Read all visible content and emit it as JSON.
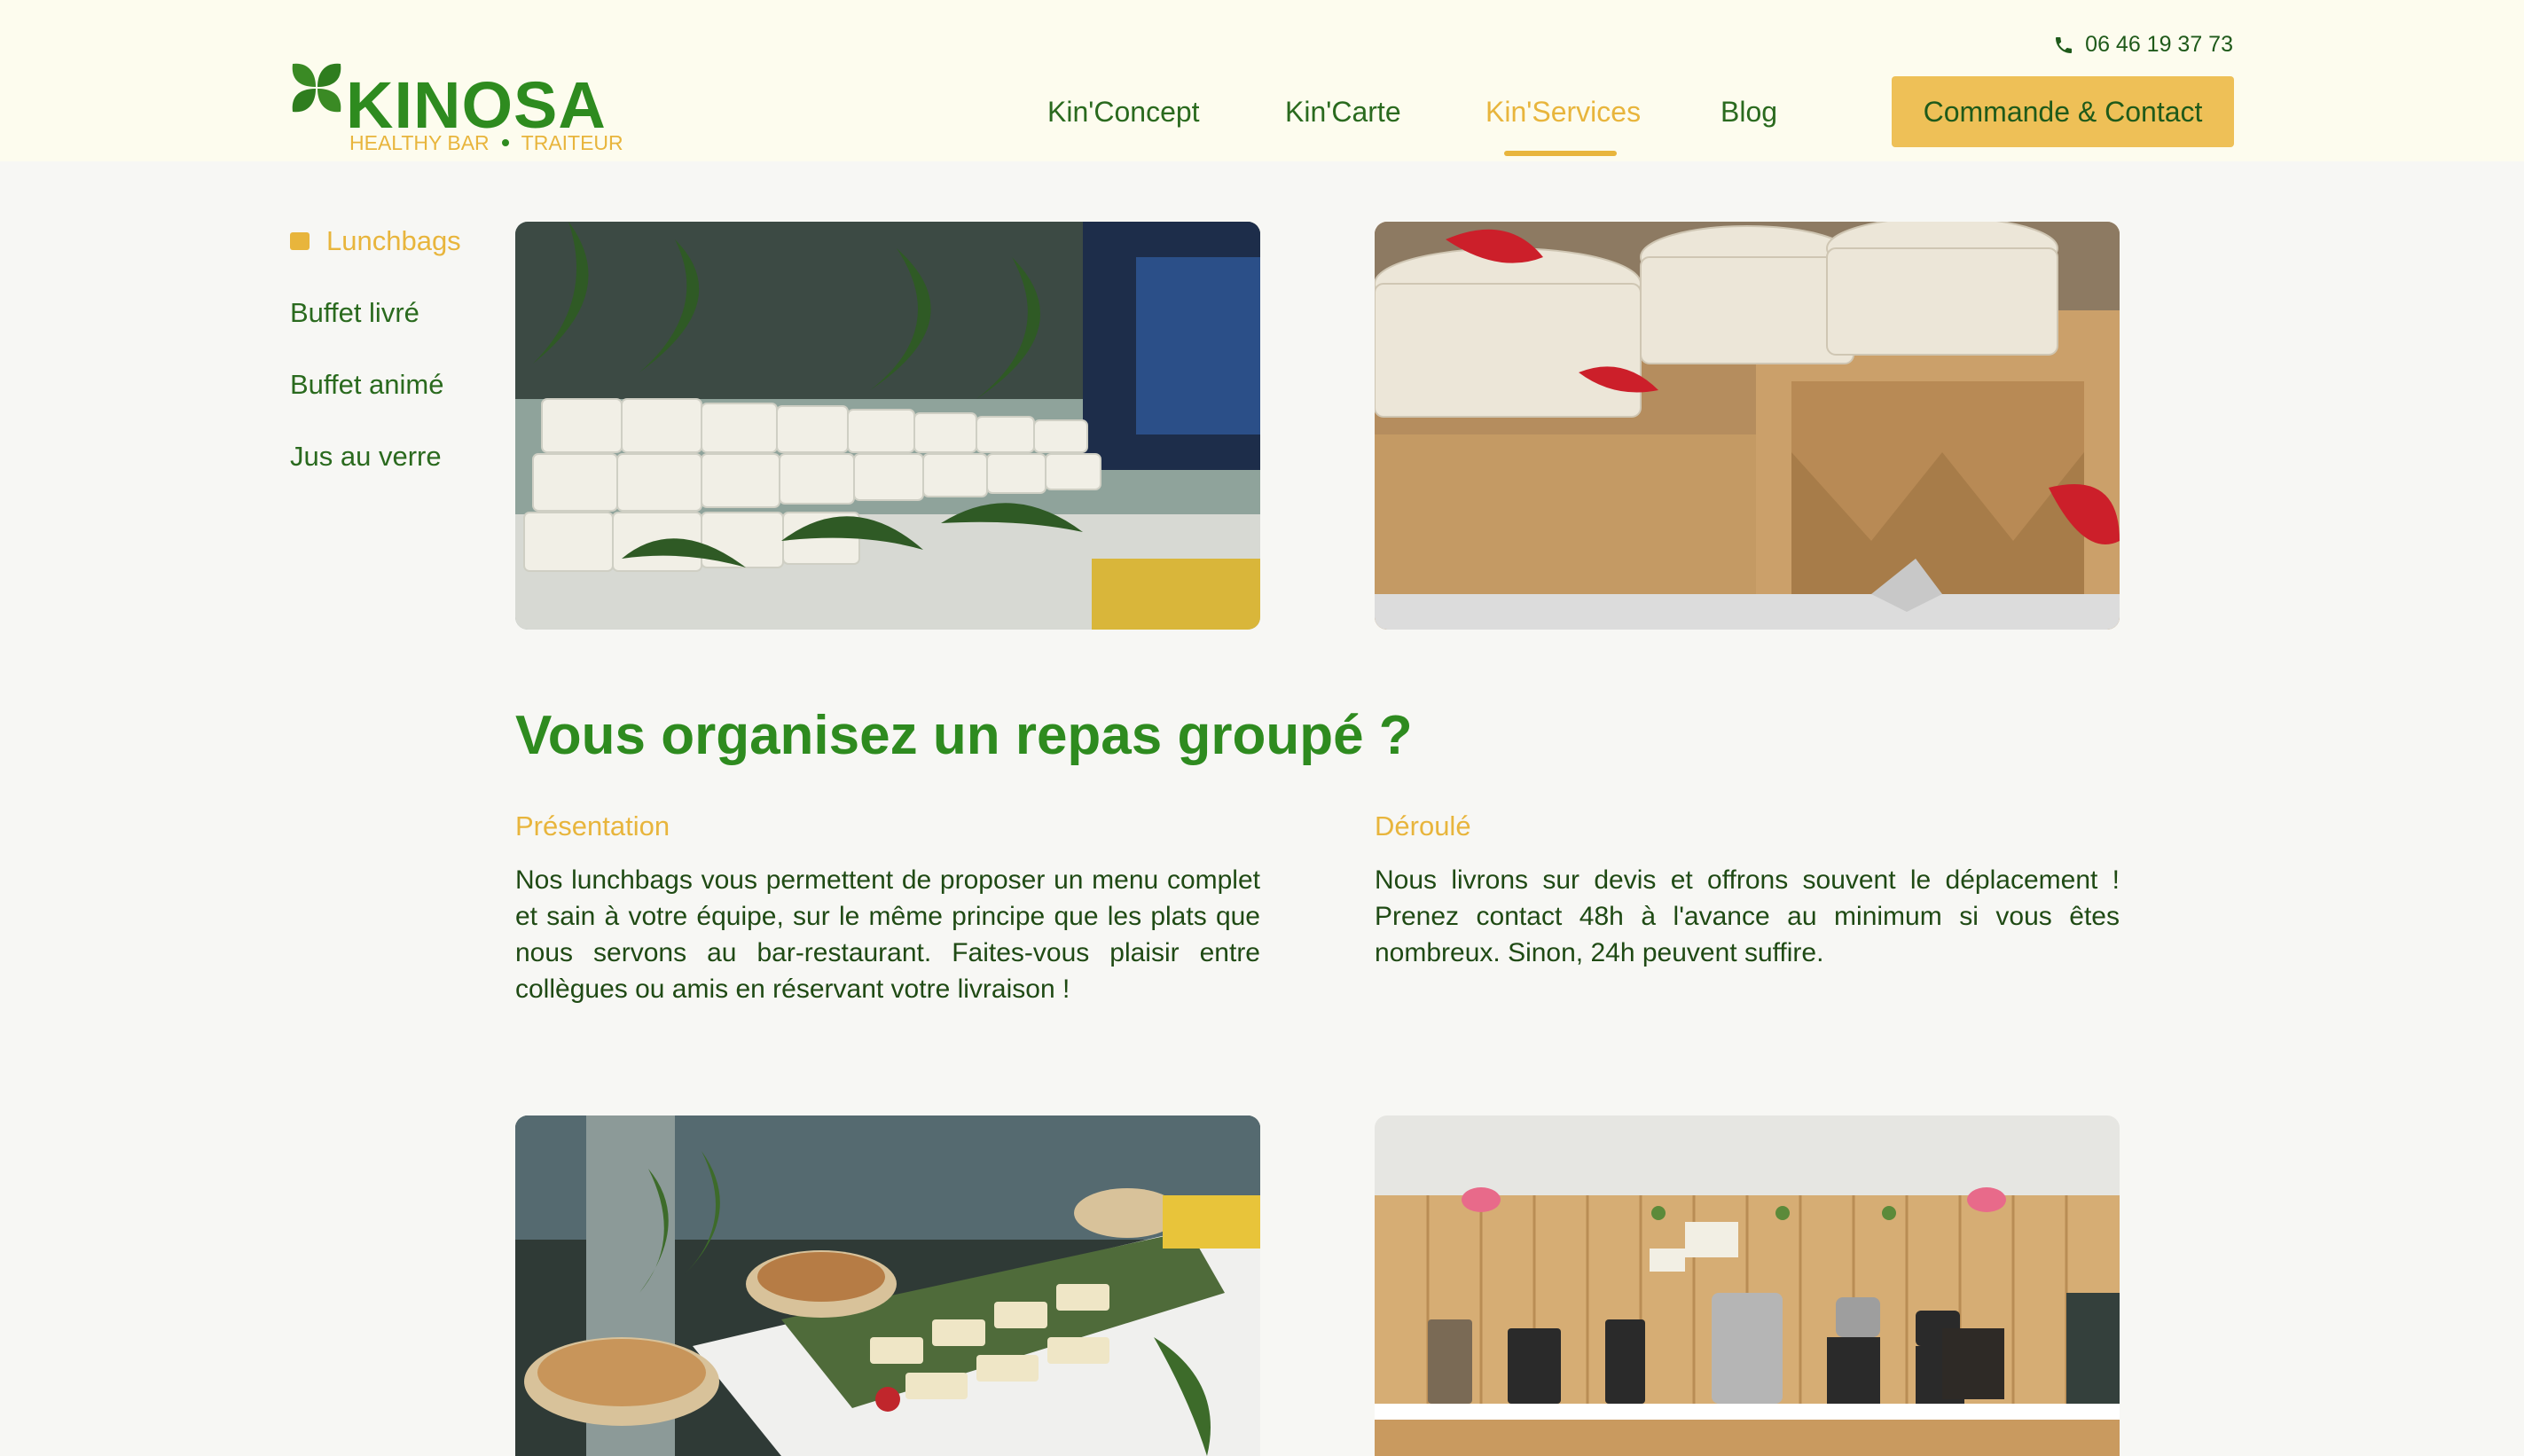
{
  "brand": {
    "name": "KINOSA",
    "tagline_left": "HEALTHY BAR",
    "tagline_right": "TRAITEUR",
    "colors": {
      "green": "#2e8b1f",
      "dark_green": "#1f5a1a",
      "accent": "#e8b53c",
      "header_bg": "#fdfcee"
    }
  },
  "header": {
    "phone": "06 46 19 37 73",
    "nav": [
      {
        "label": "Kin'Concept",
        "active": false
      },
      {
        "label": "Kin'Carte",
        "active": false
      },
      {
        "label": "Kin'Services",
        "active": true
      },
      {
        "label": "Blog",
        "active": false
      }
    ],
    "cta_label": "Commande & Contact"
  },
  "sidebar": {
    "items": [
      {
        "label": "Lunchbags",
        "active": true
      },
      {
        "label": "Buffet livré",
        "active": false
      },
      {
        "label": "Buffet animé",
        "active": false
      },
      {
        "label": "Jus au verre",
        "active": false
      }
    ]
  },
  "main": {
    "photos": [
      {
        "icon": "lunchbag-bowls-photo"
      },
      {
        "icon": "kraft-boxes-photo"
      },
      {
        "icon": "buffet-table-photo"
      },
      {
        "icon": "juice-bar-stand-photo"
      }
    ],
    "title": "Vous organisez un repas groupé ?",
    "sections": [
      {
        "heading": "Présentation",
        "text": "Nos lunchbags vous permettent de proposer un menu complet et sain à votre équipe, sur le même principe que les plats que nous servons au bar-restaurant. Faites-vous plaisir entre collègues ou amis en réservant votre livraison !"
      },
      {
        "heading": "Déroulé",
        "text": "Nous livrons sur devis et offrons souvent le déplacement ! Prenez contact 48h à l'avance au minimum si vous êtes nombreux. Sinon, 24h peuvent suffire."
      }
    ]
  }
}
